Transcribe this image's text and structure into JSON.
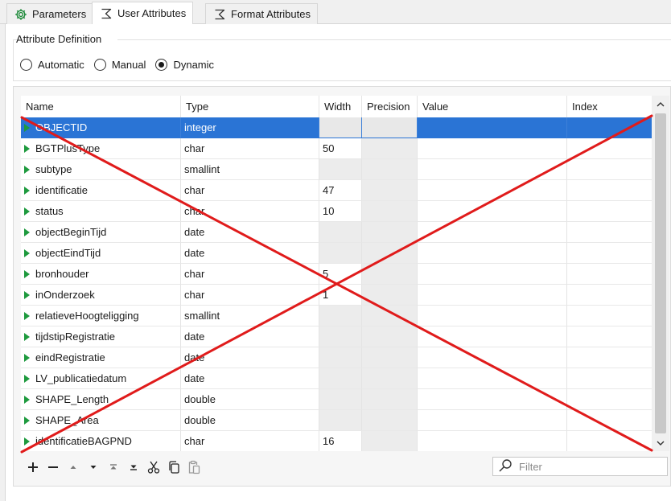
{
  "tabs": [
    {
      "label": "Parameters",
      "icon": "gear-icon",
      "active": false
    },
    {
      "label": "User Attributes",
      "icon": "sigma-icon",
      "active": true
    },
    {
      "label": "Format Attributes",
      "icon": "sigma-icon",
      "active": false
    }
  ],
  "attribute_definition": {
    "title": "Attribute Definition",
    "options": [
      "Automatic",
      "Manual",
      "Dynamic"
    ],
    "selected": "Dynamic"
  },
  "table": {
    "columns": [
      "Name",
      "Type",
      "Width",
      "Precision",
      "Value",
      "Index"
    ],
    "rows": [
      {
        "name": "OBJECTID",
        "type": "integer",
        "width": "",
        "selected": true
      },
      {
        "name": "BGTPlusType",
        "type": "char",
        "width": "50"
      },
      {
        "name": "subtype",
        "type": "smallint",
        "width": ""
      },
      {
        "name": "identificatie",
        "type": "char",
        "width": "47"
      },
      {
        "name": "status",
        "type": "char",
        "width": "10"
      },
      {
        "name": "objectBeginTijd",
        "type": "date",
        "width": ""
      },
      {
        "name": "objectEindTijd",
        "type": "date",
        "width": ""
      },
      {
        "name": "bronhouder",
        "type": "char",
        "width": "5"
      },
      {
        "name": "inOnderzoek",
        "type": "char",
        "width": "1"
      },
      {
        "name": "relatieveHoogteligging",
        "type": "smallint",
        "width": ""
      },
      {
        "name": "tijdstipRegistratie",
        "type": "date",
        "width": ""
      },
      {
        "name": "eindRegistratie",
        "type": "date",
        "width": ""
      },
      {
        "name": "LV_publicatiedatum",
        "type": "date",
        "width": ""
      },
      {
        "name": "SHAPE_Length",
        "type": "double",
        "width": ""
      },
      {
        "name": "SHAPE_Area",
        "type": "double",
        "width": ""
      },
      {
        "name": "identificatieBAGPND",
        "type": "char",
        "width": "16"
      }
    ]
  },
  "toolbar": {
    "buttons": [
      "add-icon",
      "remove-icon",
      "move-up-icon",
      "move-down-icon",
      "move-top-icon",
      "move-bottom-icon",
      "cut-icon",
      "copy-icon",
      "paste-icon"
    ]
  },
  "filter": {
    "placeholder": "Filter",
    "value": ""
  },
  "colors": {
    "selection": "#2a74d5",
    "row_marker": "#1e9a3e",
    "cross_out": "#e01b1b"
  }
}
